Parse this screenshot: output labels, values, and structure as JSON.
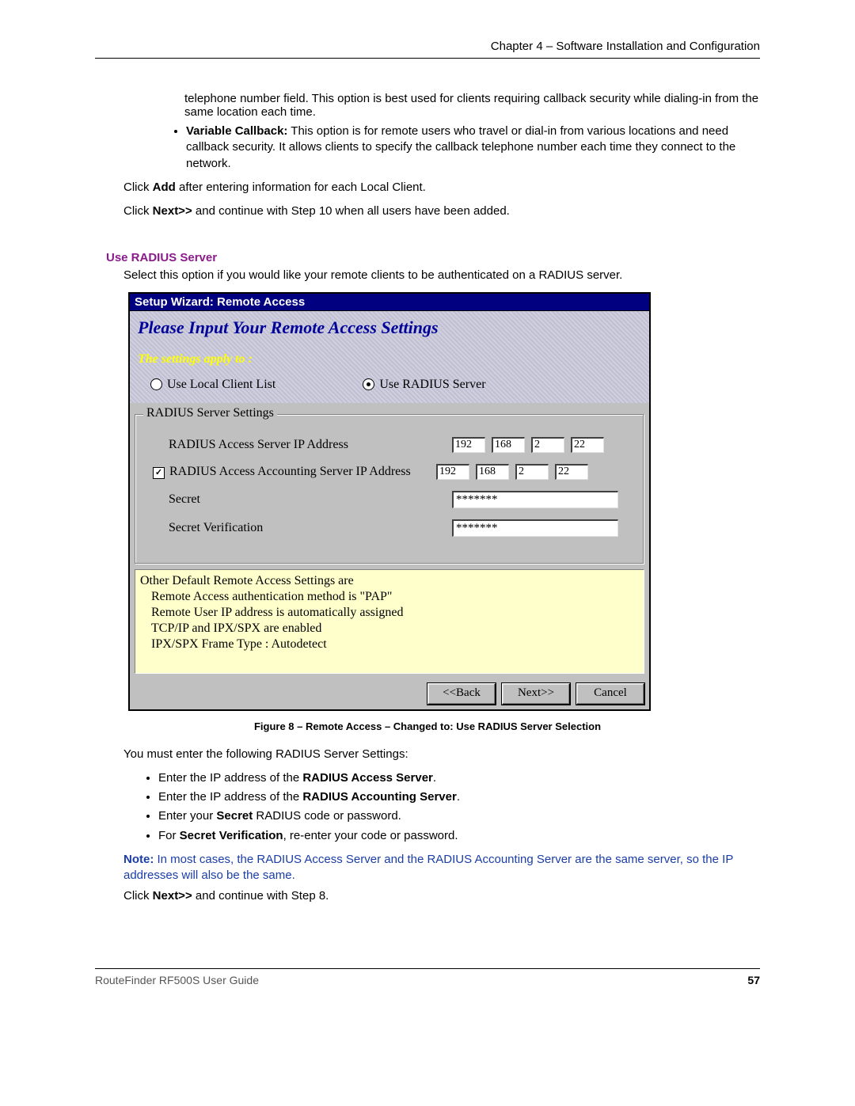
{
  "header": {
    "chapter": "Chapter 4 – Software Installation and Configuration"
  },
  "intro": {
    "telephone": "telephone number field. This option is best used for clients requiring callback security while dialing-in from the same location each time.",
    "variable_label": "Variable Callback:",
    "variable_text": " This option is for remote users who travel or dial-in from various locations and need callback security. It allows clients to specify the callback telephone number each time they connect to the network.",
    "click_add_pre": "Click ",
    "click_add_b": "Add",
    "click_add_post": " after entering information for each Local Client.",
    "click_next_pre": "Click ",
    "click_next_b": "Next>>",
    "click_next_post": " and continue with Step 10 when all users have been added."
  },
  "section": {
    "title": "Use RADIUS Server",
    "desc": "Select this option if you would like your remote clients to be authenticated on a RADIUS server."
  },
  "dlg": {
    "titlebar": "Setup Wizard: Remote Access",
    "heading": "Please Input Your Remote Access Settings",
    "apply": "The settings apply to :",
    "radio_local": "Use Local Client List",
    "radio_radius": "Use RADIUS Server",
    "legend": "RADIUS Server Settings",
    "lbl_access": "RADIUS Access Server IP Address",
    "lbl_acct": "RADIUS Access Accounting Server IP Address",
    "lbl_secret": "Secret",
    "lbl_verify": "Secret Verification",
    "ip_access": [
      "192",
      "168",
      "2",
      "22"
    ],
    "ip_acct": [
      "192",
      "168",
      "2",
      "22"
    ],
    "secret": "*******",
    "verify": "*******",
    "info_head": "Other Default Remote Access Settings are",
    "info_l1": "Remote Access authentication method is \"PAP\"",
    "info_l2": "Remote User IP address is automatically assigned",
    "info_l3": "TCP/IP and IPX/SPX are enabled",
    "info_l4": "IPX/SPX Frame Type : Autodetect",
    "btn_back": "<<Back",
    "btn_next": "Next>>",
    "btn_cancel": "Cancel"
  },
  "caption": "Figure 8 – Remote Access – Changed to:  Use RADIUS Server Selection",
  "post": {
    "intro": "You must enter the following RADIUS Server Settings:",
    "b1_pre": "Enter the IP address of the ",
    "b1_b": "RADIUS Access Server",
    "b1_post": ".",
    "b2_pre": "Enter the IP address of the ",
    "b2_b": "RADIUS Accounting Server",
    "b2_post": ".",
    "b3_pre": "Enter your ",
    "b3_b": "Secret",
    "b3_post": " RADIUS code or password.",
    "b4_pre": "For ",
    "b4_b": "Secret Verification",
    "b4_post": ", re-enter your code or password.",
    "note_b": "Note:",
    "note_txt": " In most cases, the RADIUS Access Server and the RADIUS Accounting Server are the same server, so the IP addresses will also be the same.",
    "final_pre": "Click ",
    "final_b": "Next>>",
    "final_post": " and continue with Step 8."
  },
  "footer": {
    "guide": "RouteFinder RF500S User Guide",
    "page": "57"
  }
}
